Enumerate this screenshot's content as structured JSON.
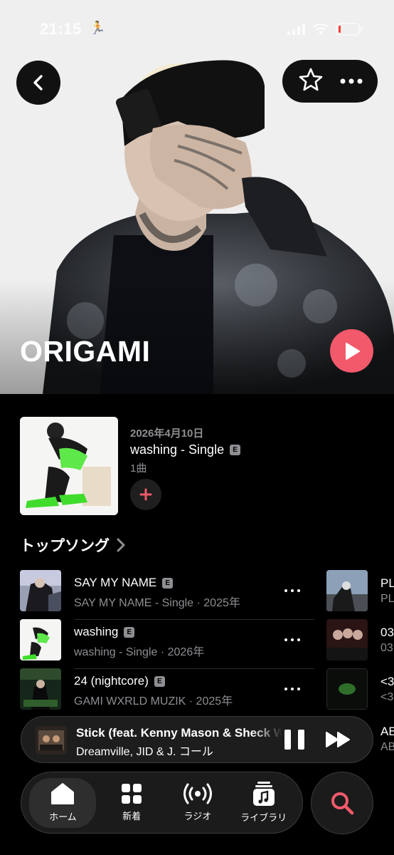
{
  "status_bar": {
    "time": "21:15"
  },
  "artist": {
    "name": "ORIGAMI"
  },
  "latest_release": {
    "date": "2026年4月10日",
    "title": "washing - Single",
    "explicit_badge": "E",
    "track_count": "1曲"
  },
  "top_songs": {
    "header": "トップソング",
    "items": [
      {
        "title": "SAY MY NAME",
        "subtitle": "SAY MY NAME - Single · 2025年"
      },
      {
        "title": "washing",
        "subtitle": "washing - Single · 2026年"
      },
      {
        "title": "24 (nightcore)",
        "subtitle": "GAMI WXRLD MUZIK · 2025年"
      }
    ],
    "side_items": [
      {
        "t1": "PL",
        "t2": "PL"
      },
      {
        "t1": "03",
        "t2": "03"
      },
      {
        "t1": "<3",
        "t2": "<3"
      },
      {
        "t1": "AB",
        "t2": "AB"
      }
    ]
  },
  "now_playing": {
    "title": "Stick (feat. Kenny Mason & Sheck Wes)",
    "artist": "Dreamville, JID & J. コール"
  },
  "tabs": [
    {
      "label": "ホーム",
      "icon": "home-icon"
    },
    {
      "label": "新着",
      "icon": "grid-icon"
    },
    {
      "label": "ラジオ",
      "icon": "radio-icon"
    },
    {
      "label": "ライブラリ",
      "icon": "library-icon"
    }
  ],
  "colors": {
    "accent": "#f2596b",
    "background": "#000000",
    "secondary_text": "#8e8e93"
  }
}
